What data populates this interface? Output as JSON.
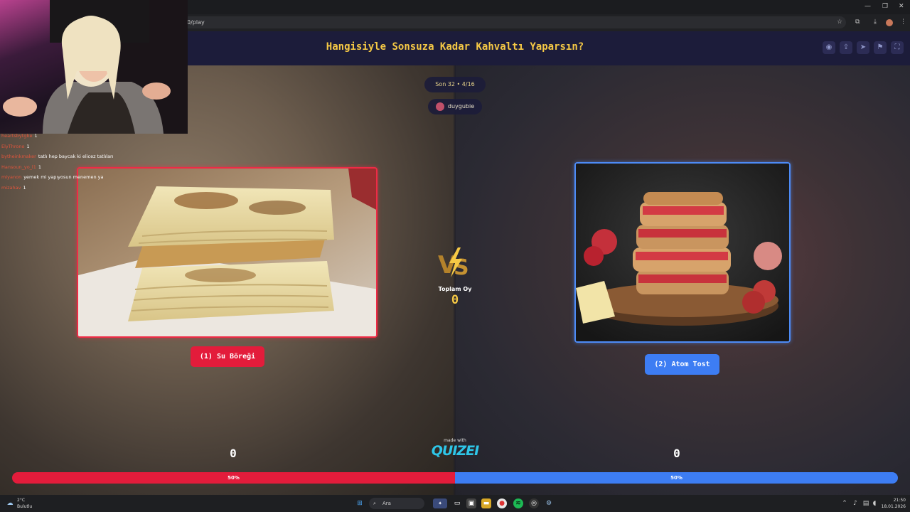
{
  "browser": {
    "url": "0/play",
    "icons": [
      "star-icon",
      "extensions-icon",
      "download-icon",
      "profile-icon",
      "menu-dots-icon"
    ]
  },
  "header": {
    "title": "Hangisiyle Sonsuza Kadar Kahvaltı Yaparsın?",
    "icons": [
      "eye-icon",
      "share-icon",
      "send-icon",
      "flag-icon",
      "fullscreen-icon"
    ]
  },
  "round": {
    "label": "Son 32 • 4/16"
  },
  "creator": {
    "name": "duygubie"
  },
  "options": [
    {
      "button_label": "(1) Su Böreği",
      "votes": "0",
      "percent_label": "50%",
      "fraction": 0.5,
      "color": "#e31c3b"
    },
    {
      "button_label": "(2) Atom Tost",
      "votes": "0",
      "percent_label": "50%",
      "fraction": 0.5,
      "color": "#3d7df3"
    }
  ],
  "total": {
    "label": "Toplam Oy",
    "value": "0"
  },
  "branding": {
    "made_with": "made with",
    "logo": "QUIZEI"
  },
  "chat": [
    {
      "name": "heartsbytgbe",
      "message": "1"
    },
    {
      "name": "ElyThrono",
      "message": "1"
    },
    {
      "name": "bytheinkmaker",
      "message": "tatlı hep baycak ki elicez tatlıları"
    },
    {
      "name": "Hansoun_yo_l1",
      "message": "1"
    },
    {
      "name": "miyanon",
      "message": "yemek mi yapıyosun menemen ya"
    },
    {
      "name": "mizahav",
      "message": "1"
    }
  ],
  "taskbar": {
    "weather_temp": "2°C",
    "weather_desc": "Bulutlu",
    "search_placeholder": "Ara",
    "time": "21:50",
    "date": "18.01.2026"
  }
}
